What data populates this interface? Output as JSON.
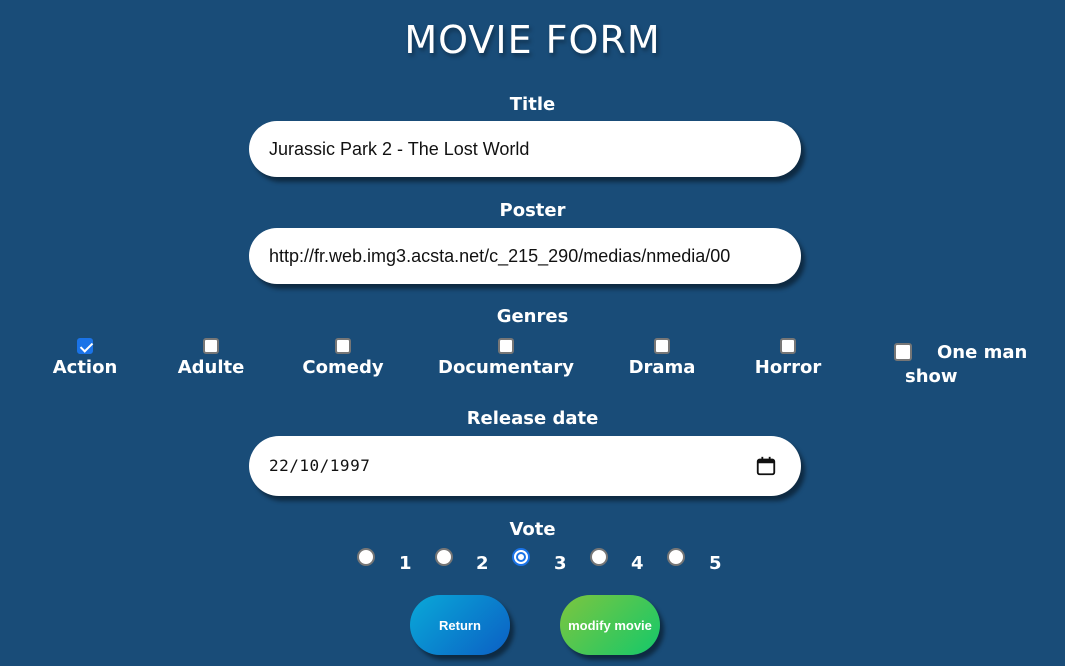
{
  "page": {
    "title": "MOVIE FORM"
  },
  "form": {
    "title_label": "Title",
    "title_value": "Jurassic Park 2 - The Lost World",
    "poster_label": "Poster",
    "poster_value": "http://fr.web.img3.acsta.net/c_215_290/medias/nmedia/00",
    "genres_label": "Genres",
    "genres": [
      {
        "label": "Action",
        "checked": true
      },
      {
        "label": "Adulte",
        "checked": false
      },
      {
        "label": "Comedy",
        "checked": false
      },
      {
        "label": "Documentary",
        "checked": false
      },
      {
        "label": "Drama",
        "checked": false
      },
      {
        "label": "Horror",
        "checked": false
      },
      {
        "label": "One man show",
        "checked": false
      }
    ],
    "release_label": "Release date",
    "release_value": "22/10/1997",
    "release_icon": "calendar-icon",
    "vote_label": "Vote",
    "vote_options": [
      "1",
      "2",
      "3",
      "4",
      "5"
    ],
    "vote_selected": "3"
  },
  "buttons": {
    "return_label": "Return",
    "modify_label": "modify movie"
  },
  "colors": {
    "background": "#194c78",
    "accent": "#1a73e8",
    "return_gradient": [
      "#0aa9d8",
      "#0b5fc4"
    ],
    "modify_gradient": [
      "#7dc63f",
      "#14c86a"
    ]
  }
}
